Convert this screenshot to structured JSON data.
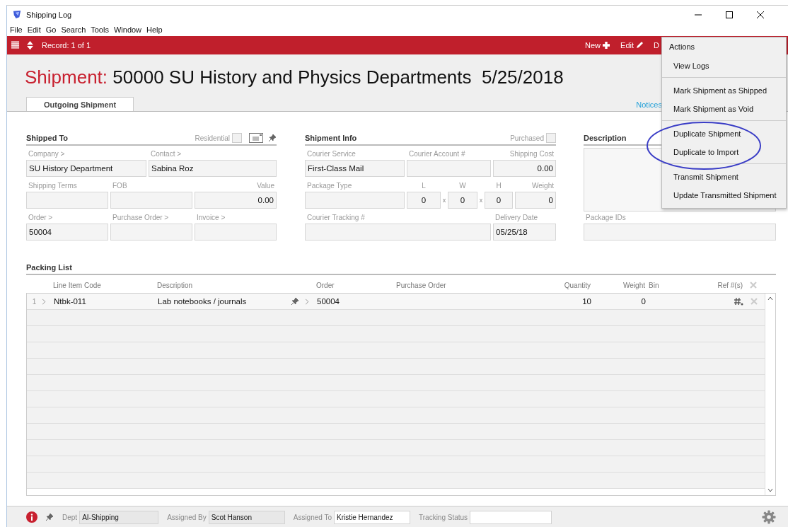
{
  "window": {
    "title": "Shipping Log"
  },
  "menu_bar": [
    "File",
    "Edit",
    "Go",
    "Search",
    "Tools",
    "Window",
    "Help"
  ],
  "toolbar": {
    "record": "Record: 1 of 1",
    "actions": [
      {
        "kind": "new",
        "label": "New"
      },
      {
        "kind": "edit",
        "label": "Edit"
      },
      {
        "kind": "plain",
        "label": "D"
      }
    ]
  },
  "header": {
    "prefix": "Shipment:",
    "title": "50000 SU History and Physics Departments  5/25/2018"
  },
  "tabs": [
    {
      "label": "Outgoing Shipment",
      "selected": true
    }
  ],
  "notices_link": "Notices",
  "shipped_to": {
    "title": "Shipped To",
    "residential": {
      "label": "Residential",
      "checked": false
    },
    "fields": [
      {
        "label": "Company >",
        "value": "SU History Department"
      },
      {
        "label": "Contact >",
        "value": "Sabina Roz"
      },
      {
        "label": "Shipping Terms"
      },
      {
        "label": "FOB"
      },
      {
        "label": "Value",
        "value": "0.00"
      },
      {
        "label": "Order >",
        "value": "50004"
      },
      {
        "label": "Purchase Order >"
      },
      {
        "label": "Invoice >"
      }
    ]
  },
  "shipment_info": {
    "title": "Shipment Info",
    "purchased": {
      "label": "Purchased",
      "checked": false
    },
    "fields": [
      {
        "label": "Courier Service",
        "value": "First-Class Mail"
      },
      {
        "label": "Courier Account #"
      },
      {
        "label": "Shipping Cost",
        "value": "0.00"
      },
      {
        "label": "Package Type"
      },
      {
        "label": "L",
        "value": "0"
      },
      {
        "label": "W",
        "value": "0",
        "prefix": "x"
      },
      {
        "label": "H",
        "value": "0",
        "prefix": "x"
      },
      {
        "label": "Weight",
        "value": "0"
      },
      {
        "label": "Courier Tracking #"
      },
      {
        "label": "Delivery Date",
        "value": "05/25/18"
      }
    ]
  },
  "description": {
    "title": "Description",
    "package_ids": {
      "label": "Package IDs"
    }
  },
  "packing_list": {
    "title": "Packing List",
    "columns": [
      "Line Item Code",
      "Description",
      "Order",
      "Purchase Order",
      "Quantity",
      "Weight",
      "Bin",
      "Ref #(s)"
    ],
    "rows": [
      {
        "number": "1",
        "code": "Ntbk-011",
        "description": "Lab notebooks / journals",
        "order": "50004",
        "quantity": "10",
        "weight": "0"
      }
    ]
  },
  "status_bar": [
    {
      "label": "Dept",
      "value": "AI-Shipping",
      "editable": false
    },
    {
      "label": "Assigned By",
      "value": "Scot Hanson",
      "editable": false
    },
    {
      "label": "Assigned To",
      "value": "Kristie Hernandez",
      "editable": true
    },
    {
      "label": "Tracking Status",
      "editable": true
    }
  ],
  "actions_menu": {
    "title": "Actions",
    "groups": [
      [
        "View Logs"
      ],
      [
        "Mark Shipment as Shipped",
        "Mark Shipment as Void"
      ],
      [
        "Duplicate Shipment",
        "Duplicate to Import"
      ],
      [
        "Transmit Shipment",
        "Update Transmitted Shipment"
      ]
    ]
  }
}
